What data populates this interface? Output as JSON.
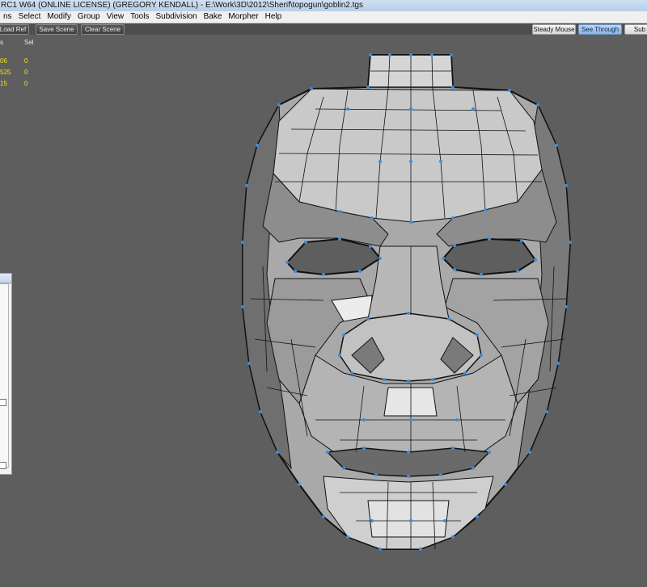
{
  "window": {
    "title": "RC1 W64  (ONLINE LICENSE) (GREGORY KENDALL) - E:\\Work\\3D\\2012\\Sherif\\topogun\\goblin2.tgs"
  },
  "menu": [
    "ns",
    "Select",
    "Modify",
    "Group",
    "View",
    "Tools",
    "Subdivision",
    "Bake",
    "Morpher",
    "Help"
  ],
  "toolbar": {
    "load_ref": "Load Ref",
    "save_scene": "Save Scene",
    "clear_scene": "Clear Scene",
    "steady_mouse": "Steady Mouse",
    "see_through": "See Through",
    "sub": "Sub"
  },
  "stats": {
    "col1_header": "s",
    "col2_header": "Sel",
    "rows": [
      {
        "count": "06",
        "sel": "0"
      },
      {
        "count": "525",
        "sel": "0"
      },
      {
        "count": "15",
        "sel": "0"
      }
    ]
  },
  "colors": {
    "viewport_bg": "#5e5e5e",
    "wire": "#111111",
    "vertex": "#3a8de0",
    "stat_value": "#f4e01a"
  },
  "viewport": {
    "object": "goblin face retopology mesh"
  }
}
